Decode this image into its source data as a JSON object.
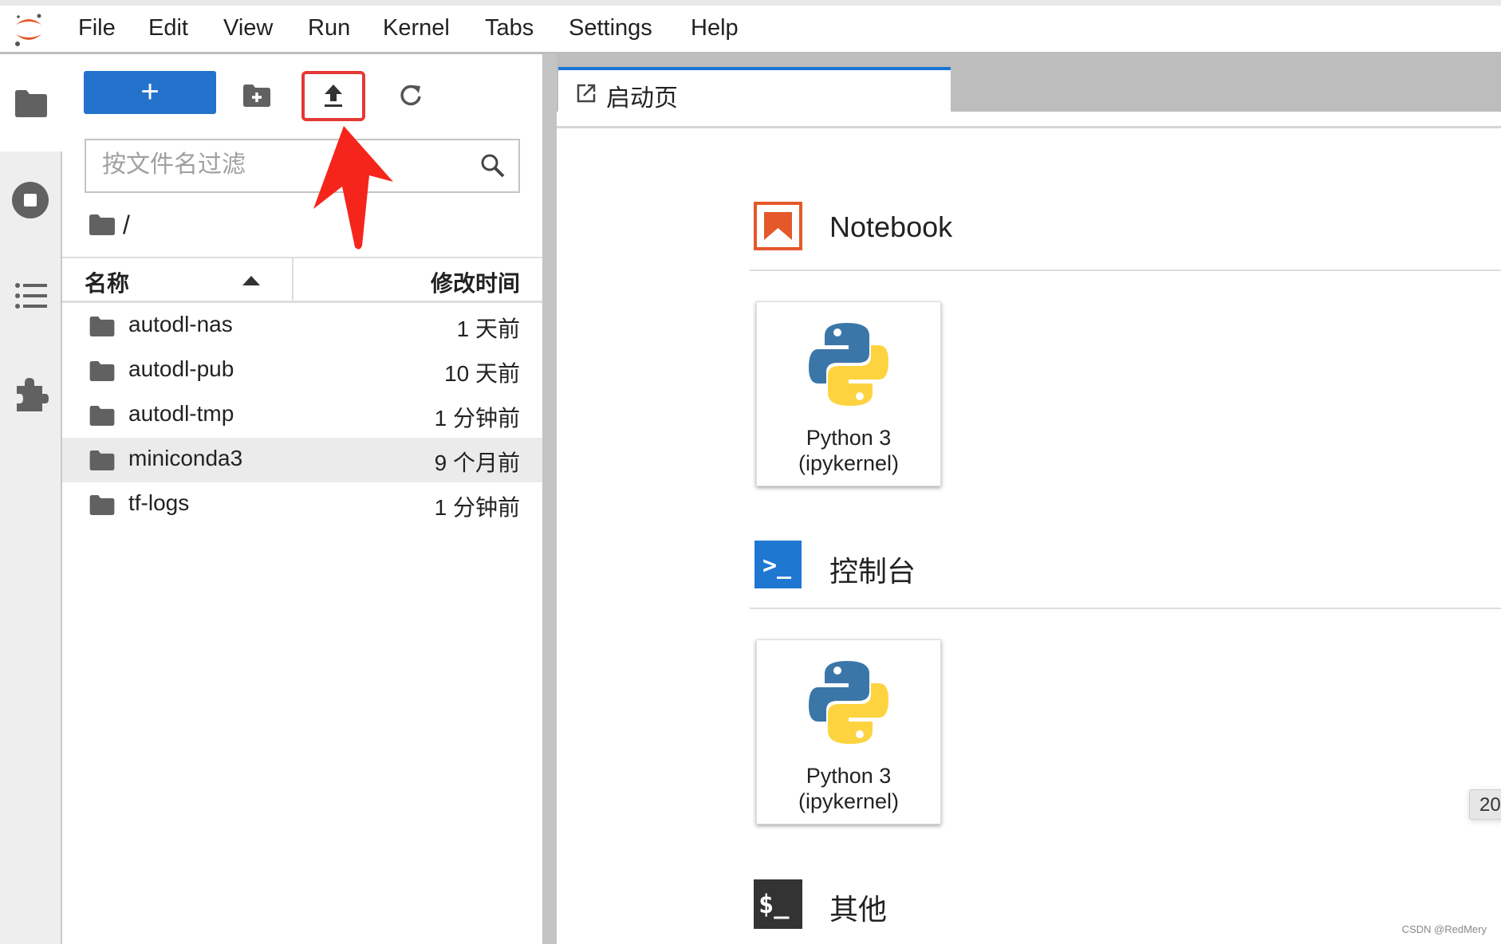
{
  "menubar": {
    "items": [
      "File",
      "Edit",
      "View",
      "Run",
      "Kernel",
      "Tabs",
      "Settings",
      "Help"
    ]
  },
  "filebrowser": {
    "new_label": "+",
    "search_placeholder": "按文件名过滤",
    "breadcrumb": "/",
    "columns": {
      "name": "名称",
      "modified": "修改时间"
    },
    "files": [
      {
        "name": "autodl-nas",
        "modified": "1 天前"
      },
      {
        "name": "autodl-pub",
        "modified": "10 天前"
      },
      {
        "name": "autodl-tmp",
        "modified": "1 分钟前"
      },
      {
        "name": "miniconda3",
        "modified": "9 个月前",
        "selected": true
      },
      {
        "name": "tf-logs",
        "modified": "1 分钟前"
      }
    ]
  },
  "tab": {
    "label": "启动页"
  },
  "launcher": {
    "sections": [
      {
        "title": "Notebook",
        "card": {
          "line1": "Python 3",
          "line2": "(ipykernel)"
        }
      },
      {
        "title": "控制台",
        "card": {
          "line1": "Python 3",
          "line2": "(ipykernel)"
        }
      },
      {
        "title": "其他"
      }
    ],
    "console_icon_text": ">_",
    "terminal_icon_text": "$_"
  },
  "badge": "20",
  "watermark": "CSDN @RedMery",
  "colors": {
    "accent": "#2372cc",
    "highlight": "#e53935",
    "notebook_icon": "#e4582a"
  }
}
